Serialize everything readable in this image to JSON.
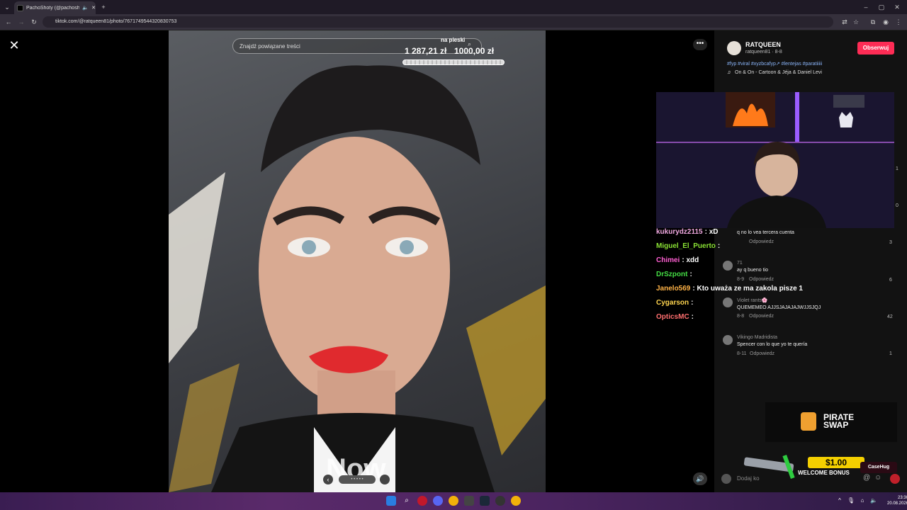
{
  "browser": {
    "tab_title": "PachoShoty (@pachoshoty)",
    "url": "tiktok.com/@ratqueen81/photo/7671749544320830753",
    "new_tab": "+",
    "window_controls": [
      "–",
      "▢",
      "✕"
    ]
  },
  "viewer": {
    "close_icon": "✕",
    "search_placeholder": "Znajdź powiązane treści",
    "more_icon": "•••",
    "overlay_text": "Now",
    "volume_icon": "🔊"
  },
  "donation": {
    "label": "na pieski",
    "current": "1 287,21 zł",
    "goal": "1000,00 zł",
    "progress": 1.0
  },
  "author": {
    "name": "RATQUEEN",
    "meta": "ratqueen81 · 8-8",
    "follow_label": "Obserwuj",
    "hashtags": "#fyp #viral #xyzbcafyp↗ #lentejas #paratiiiii",
    "music": "On & On - Cartoon & Jéja & Daniel Levi"
  },
  "comments": [
    {
      "user": "",
      "text": "q no lo vea tercera cuenta",
      "date": "",
      "reply": "Odpowiedz",
      "likes": "3"
    },
    {
      "user": "71",
      "text": "ay q bueno tio",
      "date": "8-9",
      "reply": "Odpowiedz",
      "likes": "6"
    },
    {
      "user": "Violet rants🌸",
      "text": "QUEMEMEO AJJSJAJAJAJWJJSJQJ",
      "date": "8-8",
      "reply": "Odpowiedz",
      "likes": "42"
    },
    {
      "user": "Vikingo Madridista",
      "text": "Spencer con lo que yo te quería",
      "date": "8-11",
      "reply": "Odpowiedz",
      "likes": "1"
    }
  ],
  "side_counts": [
    "1",
    "0"
  ],
  "chat": [
    {
      "user": "kukurydz2115",
      "msg": ": xD",
      "color": "#f0a8e0"
    },
    {
      "user": "Miguel_El_Puerto",
      "msg": ":",
      "color": "#8ae234"
    },
    {
      "user": "Chimei",
      "msg": ": xdd",
      "color": "#ff5fd2"
    },
    {
      "user": "DrSzpont",
      "msg": ":",
      "color": "#44dd44"
    },
    {
      "user": "Janelo569",
      "msg": ": Kto uważa ze ma zakola pisze 1",
      "color": "#ffb347"
    },
    {
      "user": "Cygarson",
      "msg": ":",
      "color": "#ffd54f"
    },
    {
      "user": "OpticsMC",
      "msg": ":",
      "color": "#ff6f6f"
    }
  ],
  "ads": {
    "pirate_line1": "PIRATE",
    "pirate_line2": "SWAP",
    "bonus_amount": "$1.00",
    "bonus_text": "WELCOME BONUS",
    "casehug": "CaseHug"
  },
  "comment_input_placeholder": "Dodaj ko",
  "taskbar": {
    "time": "23:30",
    "date": "20.08.2026"
  },
  "colors": {
    "accent": "#fe2c55",
    "link": "#8ab4f8"
  }
}
